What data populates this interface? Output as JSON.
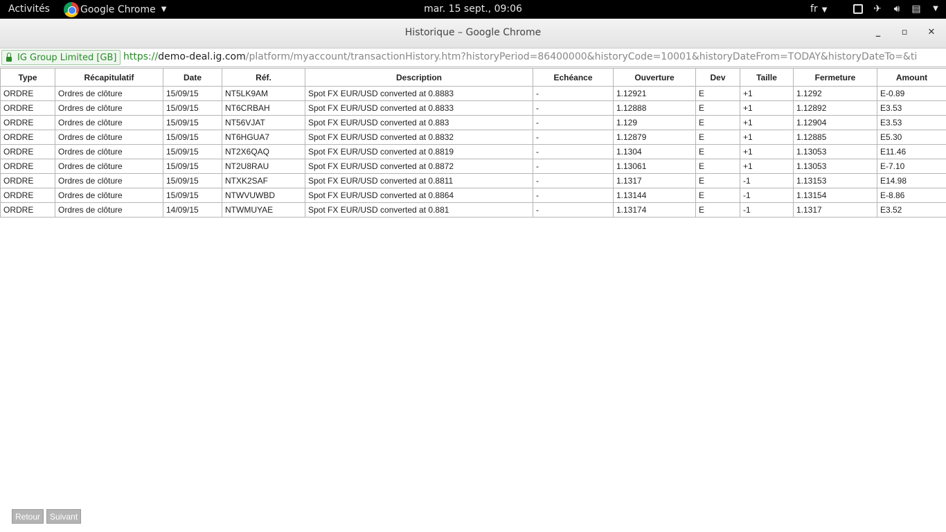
{
  "topbar": {
    "activities": "Activités",
    "app_name": "Google Chrome",
    "clock": "mar. 15 sept., 09:06",
    "lang": "fr"
  },
  "window": {
    "title": "Historique – Google Chrome"
  },
  "address": {
    "ssl_label": "IG Group Limited [GB]",
    "scheme": "https://",
    "host": "demo-deal.ig.com",
    "path": "/platform/myaccount/transactionHistory.htm?historyPeriod=86400000&historyCode=10001&historyDateFrom=TODAY&historyDateTo=&ti"
  },
  "table": {
    "headers": [
      "Type",
      "Récapitulatif",
      "Date",
      "Réf.",
      "Description",
      "Echéance",
      "Ouverture",
      "Dev",
      "Taille",
      "Fermeture",
      "Amount"
    ],
    "rows": [
      [
        "ORDRE",
        "Ordres de clôture",
        "15/09/15",
        "NT5LK9AM",
        "Spot FX EUR/USD converted at 0.8883",
        "-",
        "1.12921",
        "E",
        "+1",
        "1.1292",
        "E-0.89"
      ],
      [
        "ORDRE",
        "Ordres de clôture",
        "15/09/15",
        "NT6CRBAH",
        "Spot FX EUR/USD converted at 0.8833",
        "-",
        "1.12888",
        "E",
        "+1",
        "1.12892",
        "E3.53"
      ],
      [
        "ORDRE",
        "Ordres de clôture",
        "15/09/15",
        "NT56VJAT",
        "Spot FX EUR/USD converted at 0.883",
        "-",
        "1.129",
        "E",
        "+1",
        "1.12904",
        "E3.53"
      ],
      [
        "ORDRE",
        "Ordres de clôture",
        "15/09/15",
        "NT6HGUA7",
        "Spot FX EUR/USD converted at 0.8832",
        "-",
        "1.12879",
        "E",
        "+1",
        "1.12885",
        "E5.30"
      ],
      [
        "ORDRE",
        "Ordres de clôture",
        "15/09/15",
        "NT2X6QAQ",
        "Spot FX EUR/USD converted at 0.8819",
        "-",
        "1.1304",
        "E",
        "+1",
        "1.13053",
        "E11.46"
      ],
      [
        "ORDRE",
        "Ordres de clôture",
        "15/09/15",
        "NT2U8RAU",
        "Spot FX EUR/USD converted at 0.8872",
        "-",
        "1.13061",
        "E",
        "+1",
        "1.13053",
        "E-7.10"
      ],
      [
        "ORDRE",
        "Ordres de clôture",
        "15/09/15",
        "NTXK2SAF",
        "Spot FX EUR/USD converted at 0.8811",
        "-",
        "1.1317",
        "E",
        "-1",
        "1.13153",
        "E14.98"
      ],
      [
        "ORDRE",
        "Ordres de clôture",
        "15/09/15",
        "NTWVUWBD",
        "Spot FX EUR/USD converted at 0.8864",
        "-",
        "1.13144",
        "E",
        "-1",
        "1.13154",
        "E-8.86"
      ],
      [
        "ORDRE",
        "Ordres de clôture",
        "14/09/15",
        "NTWMUYAE",
        "Spot FX EUR/USD converted at 0.881",
        "-",
        "1.13174",
        "E",
        "-1",
        "1.1317",
        "E3.52"
      ]
    ]
  },
  "footer": {
    "back_label": "Retour",
    "next_label": "Suivant"
  }
}
